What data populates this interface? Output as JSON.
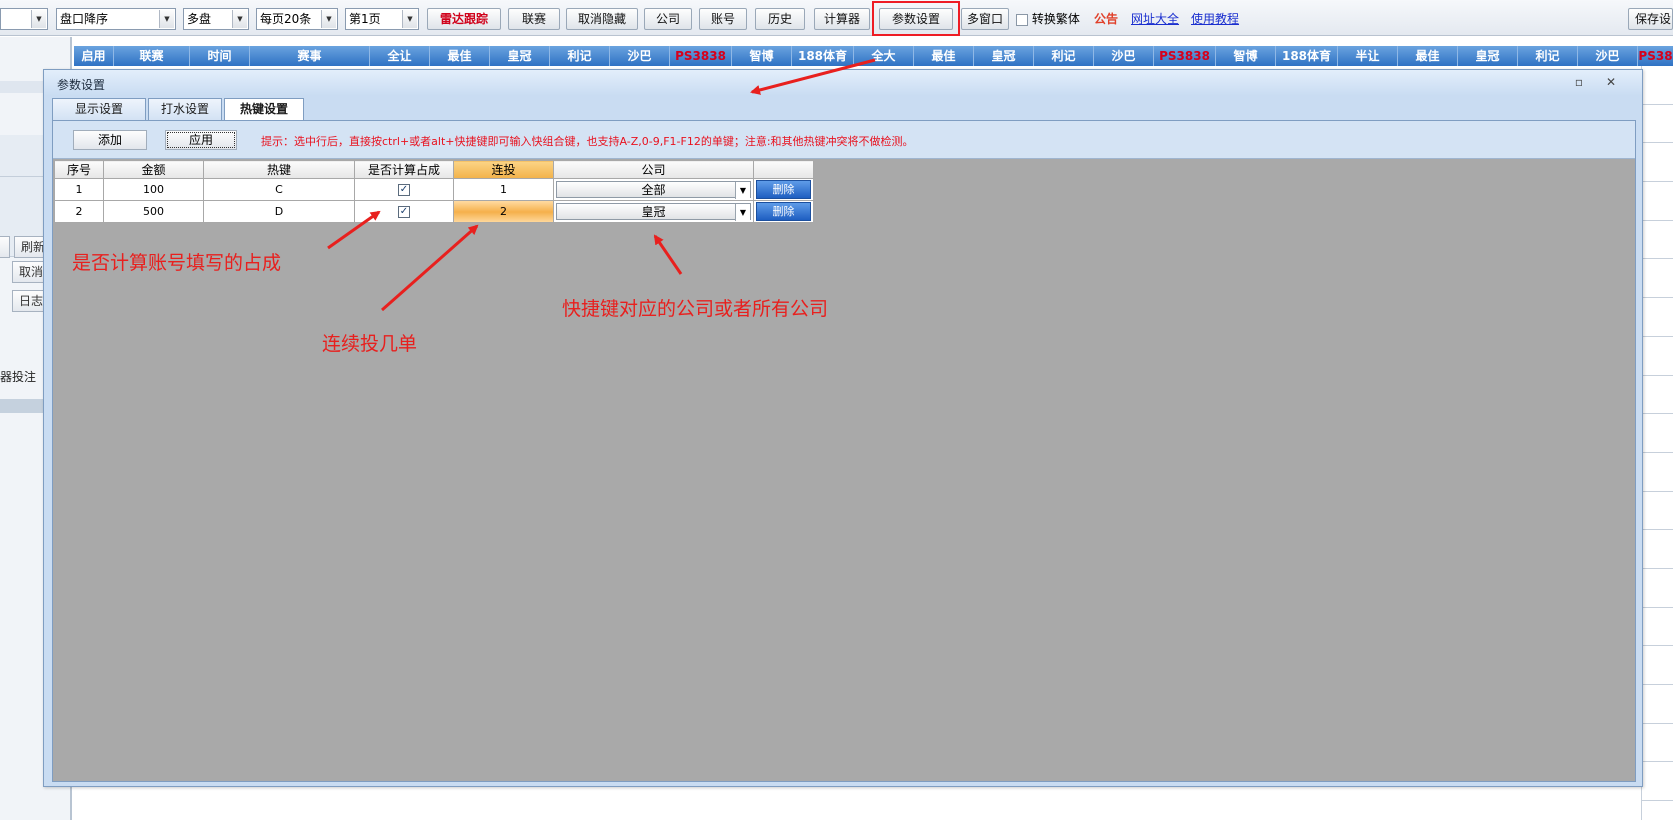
{
  "toolbar": {
    "combos": [
      "",
      "盘口降序",
      "多盘",
      "每页20条",
      "第1页"
    ],
    "buttons": [
      "雷达跟踪",
      "联赛",
      "取消隐藏",
      "公司",
      "账号",
      "历史",
      "计算器",
      "参数设置",
      "多窗口"
    ],
    "checkbox_label": "转换繁体",
    "notice": "公告",
    "links": [
      "网址大全",
      "使用教程"
    ],
    "save_button": "保存设"
  },
  "left_panel": {
    "buttons": [
      "刷新",
      "取消",
      "日志"
    ],
    "text": "器投注"
  },
  "header_columns": [
    "启用",
    "联赛",
    "时间",
    "赛事",
    "全让",
    "最佳",
    "皇冠",
    "利记",
    "沙巴",
    "PS3838",
    "智博",
    "188体育",
    "全大",
    "最佳",
    "皇冠",
    "利记",
    "沙巴",
    "PS3838",
    "智博",
    "188体育",
    "半让",
    "最佳",
    "皇冠",
    "利记",
    "沙巴",
    "PS38"
  ],
  "dialog": {
    "title": "参数设置",
    "tabs": [
      "显示设置",
      "打水设置",
      "热键设置"
    ],
    "add_button": "添加",
    "apply_button": "应用",
    "tip": "提示：选中行后，直接按ctrl+或者alt+快捷键即可输入快组合键，也支持A-Z,0-9,F1-F12的单键；注意:和其他热键冲突将不做检测。",
    "columns": [
      "序号",
      "金额",
      "热键",
      "是否计算占成",
      "连投",
      "公司",
      ""
    ],
    "rows": [
      {
        "no": "1",
        "amount": "100",
        "hotkey": "C",
        "calc": "✓",
        "repeat": "1",
        "company": "全部",
        "delete": "删除"
      },
      {
        "no": "2",
        "amount": "500",
        "hotkey": "D",
        "calc": "✓",
        "repeat": "2",
        "company": "皇冠",
        "delete": "删除"
      }
    ]
  },
  "annotations": {
    "calc_note": "是否计算账号填写的占成",
    "repeat_note": "连续投几单",
    "company_note": "快捷键对应的公司或者所有公司"
  },
  "colors": {
    "annotation": "#e8201e",
    "header_blue": "#2f72c4",
    "highlight_box": "#ee1c25"
  }
}
